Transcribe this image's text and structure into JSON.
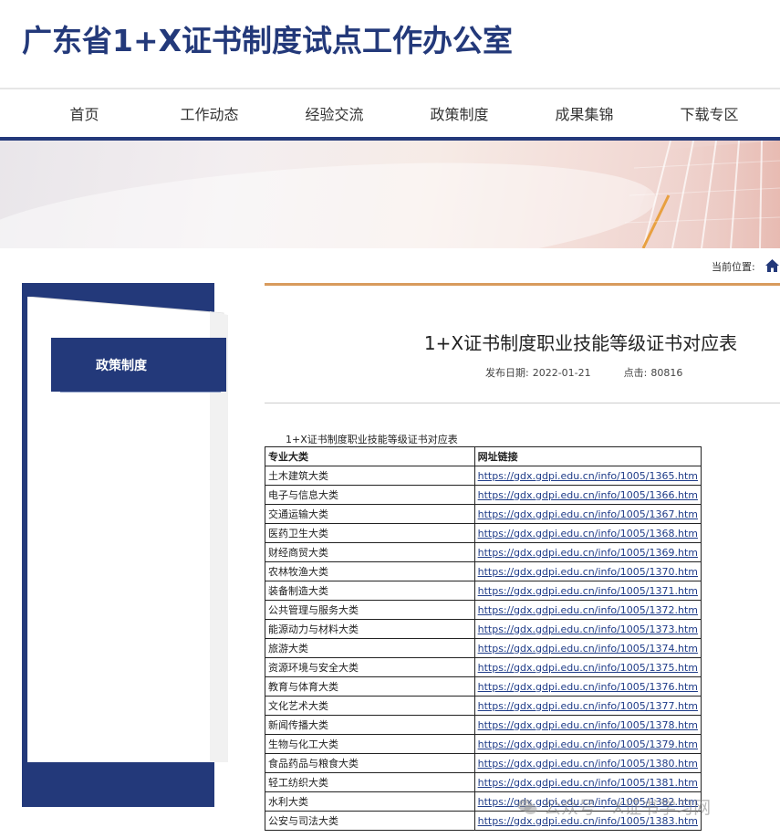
{
  "site": {
    "title": "广东省1+X证书制度试点工作办公室"
  },
  "nav": {
    "items": [
      "首页",
      "工作动态",
      "经验交流",
      "政策制度",
      "成果集锦",
      "下载专区"
    ]
  },
  "breadcrumb": {
    "label": "当前位置:"
  },
  "sidebar": {
    "active_label": "政策制度"
  },
  "article": {
    "title": "1+X证书制度职业技能等级证书对应表",
    "publish_label": "发布日期:",
    "publish_date": "2022-01-21",
    "clicks_label": "点击:",
    "clicks": "80816",
    "table_caption": "1+X证书制度职业技能等级证书对应表",
    "table": {
      "headers": [
        "专业大类",
        "网址链接"
      ],
      "rows": [
        [
          "土木建筑大类",
          "https://gdx.gdpi.edu.cn/info/1005/1365.htm"
        ],
        [
          "电子与信息大类",
          "https://gdx.gdpi.edu.cn/info/1005/1366.htm"
        ],
        [
          "交通运输大类",
          "https://gdx.gdpi.edu.cn/info/1005/1367.htm"
        ],
        [
          "医药卫生大类",
          "https://gdx.gdpi.edu.cn/info/1005/1368.htm"
        ],
        [
          "财经商贸大类",
          "https://gdx.gdpi.edu.cn/info/1005/1369.htm"
        ],
        [
          "农林牧渔大类",
          "https://gdx.gdpi.edu.cn/info/1005/1370.htm"
        ],
        [
          "装备制造大类",
          "https://gdx.gdpi.edu.cn/info/1005/1371.htm"
        ],
        [
          "公共管理与服务大类",
          "https://gdx.gdpi.edu.cn/info/1005/1372.htm"
        ],
        [
          "能源动力与材料大类",
          "https://gdx.gdpi.edu.cn/info/1005/1373.htm"
        ],
        [
          "旅游大类",
          "https://gdx.gdpi.edu.cn/info/1005/1374.htm"
        ],
        [
          "资源环境与安全大类",
          "https://gdx.gdpi.edu.cn/info/1005/1375.htm"
        ],
        [
          "教育与体育大类",
          "https://gdx.gdpi.edu.cn/info/1005/1376.htm"
        ],
        [
          "文化艺术大类",
          "https://gdx.gdpi.edu.cn/info/1005/1377.htm"
        ],
        [
          "新闻传播大类",
          "https://gdx.gdpi.edu.cn/info/1005/1378.htm"
        ],
        [
          "生物与化工大类",
          "https://gdx.gdpi.edu.cn/info/1005/1379.htm"
        ],
        [
          "食品药品与粮食大类",
          "https://gdx.gdpi.edu.cn/info/1005/1380.htm"
        ],
        [
          "轻工纺织大类",
          "https://gdx.gdpi.edu.cn/info/1005/1381.htm"
        ],
        [
          "水利大类",
          "https://gdx.gdpi.edu.cn/info/1005/1382.htm"
        ],
        [
          "公安与司法大类",
          "https://gdx.gdpi.edu.cn/info/1005/1383.htm"
        ]
      ]
    }
  },
  "watermark": {
    "text": "公众号 · X证书学习网",
    "icon": "wechat-icon"
  },
  "colors": {
    "brand_navy": "#23397a",
    "accent_orange": "#d89b5d",
    "link": "#1f3c88"
  }
}
